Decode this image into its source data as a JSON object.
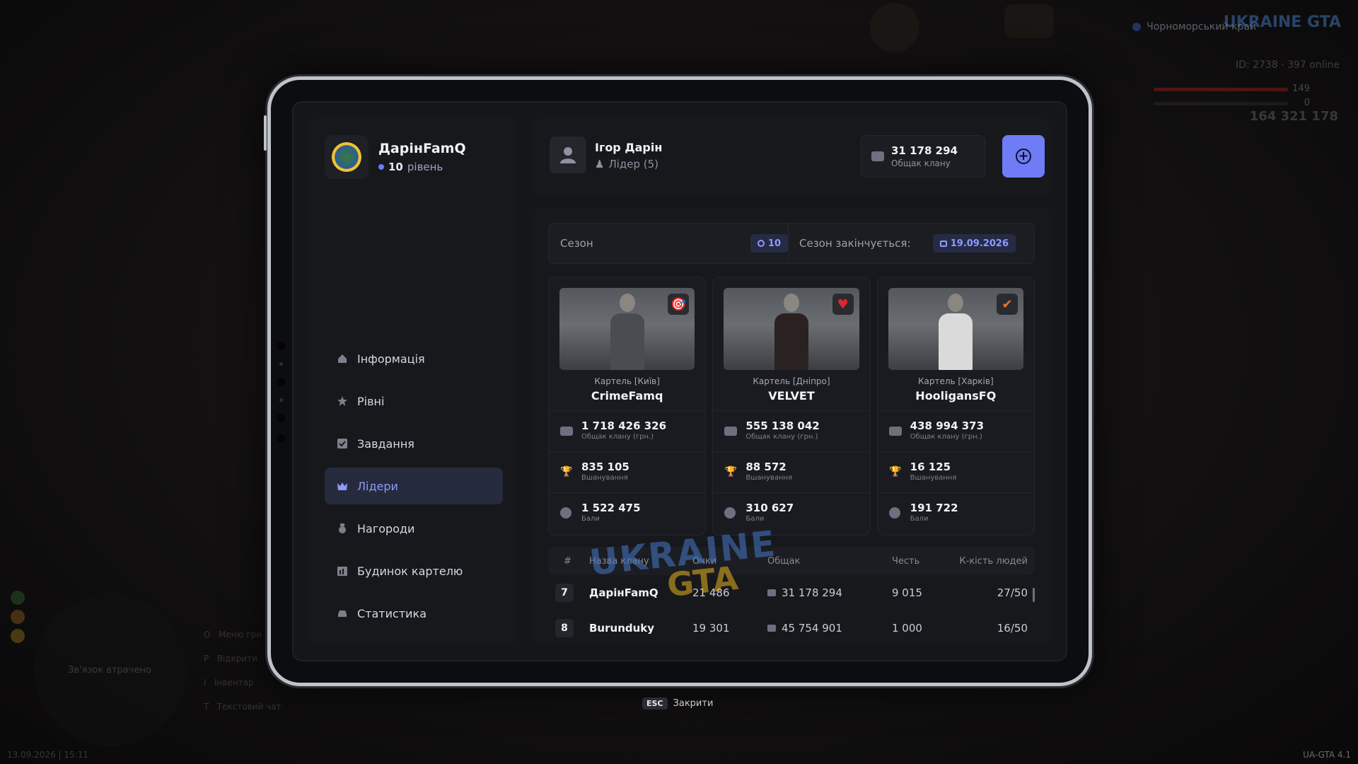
{
  "hud": {
    "region": "Чорноморський край",
    "logo": "UKRAINE GTA",
    "id_text": "ID: 2738",
    "online": "397 online",
    "hp": "149",
    "armor": "0",
    "money": "164 321 178",
    "minimap_text": "Зв'язок втрачено",
    "key_hints": [
      "Меню гри",
      "Відкрити",
      "Інвентар",
      "Текстовий чат"
    ],
    "key_letters": [
      "O",
      "P",
      "I",
      "T"
    ],
    "date": "13.09.2026 | 15:11",
    "version": "UA-GTA 4.1"
  },
  "profile": {
    "name": "ДарінFamQ",
    "level_number": "10",
    "level_label": "рівень"
  },
  "nav": [
    {
      "label": "Інформація",
      "icon": "home-icon"
    },
    {
      "label": "Рівні",
      "icon": "star-icon"
    },
    {
      "label": "Завдання",
      "icon": "checkbox-icon"
    },
    {
      "label": "Лідери",
      "icon": "crown-icon",
      "active": true
    },
    {
      "label": "Нагороди",
      "icon": "medal-icon"
    },
    {
      "label": "Будинок картелю",
      "icon": "building-icon"
    },
    {
      "label": "Статистика",
      "icon": "car-icon"
    }
  ],
  "leader": {
    "name": "Ігор Дарін",
    "role": "Лідер (5)",
    "bank_value": "31 178 294",
    "bank_label": "Общак клану"
  },
  "season": {
    "label": "Сезон",
    "number": "10",
    "ends_label": "Сезон закінчується:",
    "ends_date": "19.09.2026"
  },
  "top_cards": [
    {
      "cartel": "Картель [Київ]",
      "name": "CrimeFamq",
      "bank": "1 718 426 326",
      "bank_label": "Общак клану (грн.)",
      "honor": "835 105",
      "honor_label": "Вшанування",
      "points": "1 522 475",
      "points_label": "Бали",
      "badge": "gun-icon"
    },
    {
      "cartel": "Картель [Дніпро]",
      "name": "VELVET",
      "bank": "555 138 042",
      "bank_label": "Общак клану (грн.)",
      "honor": "88 572",
      "honor_label": "Вшанування",
      "points": "310 627",
      "points_label": "Бали",
      "badge": "heart-icon"
    },
    {
      "cartel": "Картель [Харків]",
      "name": "HooligansFQ",
      "bank": "438 994 373",
      "bank_label": "Общак клану (грн.)",
      "honor": "16 125",
      "honor_label": "Вшанування",
      "points": "191 722",
      "points_label": "Бали",
      "badge": "nike-icon"
    }
  ],
  "watermark": {
    "line1": "UKRAINE",
    "line2": "GTA"
  },
  "table": {
    "headers": {
      "num": "#",
      "name": "Назва клану",
      "points": "Очки",
      "bank": "Общак",
      "honor": "Честь",
      "people": "К-кість людей"
    },
    "rows": [
      {
        "num": "7",
        "name": "ДарінFamQ",
        "points": "21 486",
        "bank": "31 178 294",
        "honor": "9 015",
        "people": "27/50"
      },
      {
        "num": "8",
        "name": "Burunduky",
        "points": "19 301",
        "bank": "45 754 901",
        "honor": "1 000",
        "people": "16/50"
      }
    ]
  },
  "esc": {
    "key": "ESC",
    "label": "Закрити"
  },
  "colors": {
    "accent": "#6f7cf6",
    "accent_text": "#8e9bff",
    "panel": "#17181c",
    "heart": "#e0262e"
  }
}
